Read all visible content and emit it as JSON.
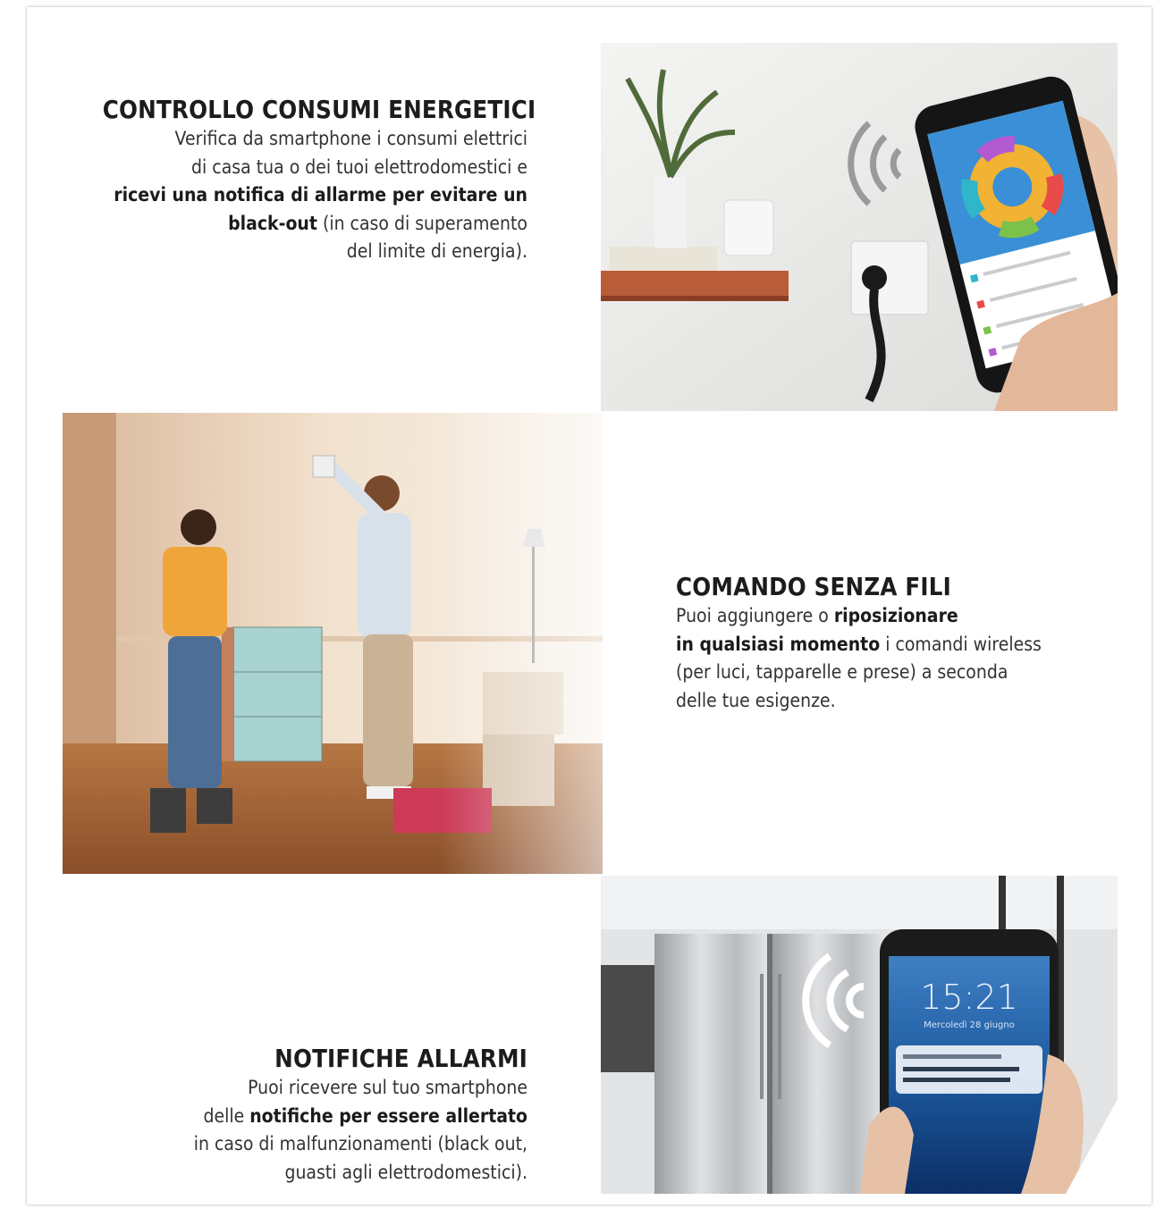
{
  "sections": [
    {
      "title": "CONTROLLO CONSUMI ENERGETICI",
      "lines": [
        {
          "pre": "Verifica da smartphone i consumi elettrici",
          "bold": "",
          "post": ""
        },
        {
          "pre": "di casa tua o dei tuoi elettrodomestici e",
          "bold": "",
          "post": ""
        },
        {
          "pre": "",
          "bold": "ricevi una notifica di allarme per evitare un",
          "post": ""
        },
        {
          "pre": "",
          "bold": "black-out",
          "post": " (in caso di superamento"
        },
        {
          "pre": "del limite di energia).",
          "bold": "",
          "post": ""
        }
      ]
    },
    {
      "title": "COMANDO SENZA FILI",
      "lines": [
        {
          "pre": "Puoi  aggiungere o ",
          "bold": "riposizionare",
          "post": ""
        },
        {
          "pre": "",
          "bold": "in qualsiasi momento",
          "post": " i comandi wireless"
        },
        {
          "pre": "(per luci, tapparelle e prese) a seconda",
          "bold": "",
          "post": ""
        },
        {
          "pre": "delle tue esigenze.",
          "bold": "",
          "post": ""
        }
      ]
    },
    {
      "title": "NOTIFICHE ALLARMI",
      "lines": [
        {
          "pre": "Puoi ricevere sul tuo smartphone",
          "bold": "",
          "post": ""
        },
        {
          "pre": "delle ",
          "bold": "notifiche per essere allertato",
          "post": ""
        },
        {
          "pre": "in caso di malfunzionamenti (black out,",
          "bold": "",
          "post": ""
        },
        {
          "pre": "guasti agli elettrodomestici).",
          "bold": "",
          "post": ""
        }
      ]
    }
  ],
  "phone_clock": {
    "time": "15:21",
    "date": "Mercoledì 28 giugno"
  },
  "colors": {
    "accent_blue": "#3a8fd6",
    "wall": "#ececea",
    "shelf": "#b85c3a"
  }
}
